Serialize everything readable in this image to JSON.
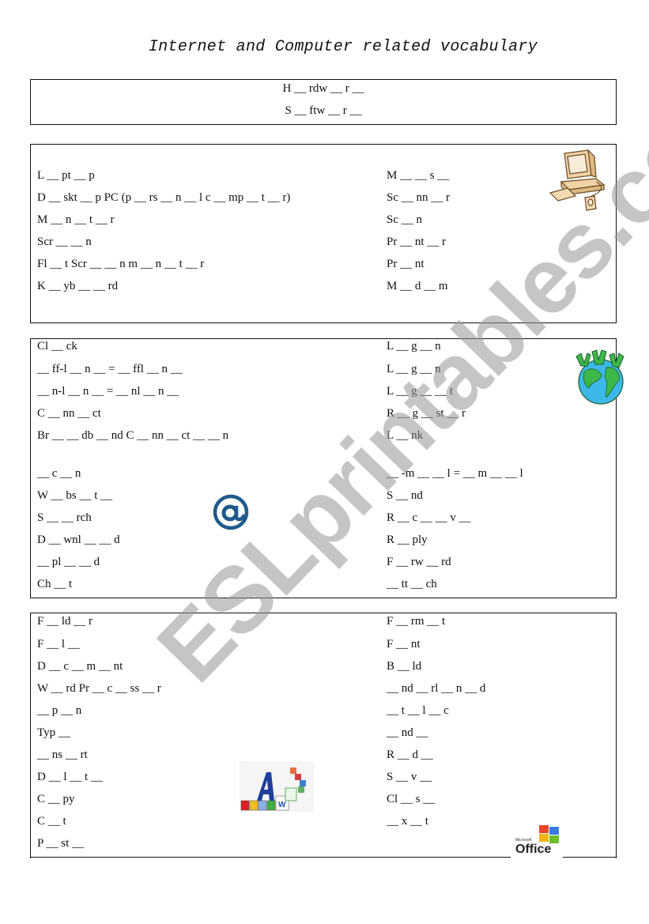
{
  "title": "Internet and Computer related vocabulary",
  "watermark": "ESLprintables.com",
  "box1": {
    "items": [
      "H __ rdw __ r __",
      "S __ ftw __ r __"
    ]
  },
  "box2": {
    "left": [
      "L __ pt __ p",
      "D __ skt __ p PC (p __ rs __ n __ l c __ mp __ t __ r)",
      "M __ n __ t __ r",
      "Scr __  __ n",
      "Fl __ t Scr __  __ n m __ n __ t __ r",
      "K __ yb __  __ rd"
    ],
    "right": [
      "M __  __ s __",
      "Sc __ nn __ r",
      "Sc __ n",
      "Pr __ nt __ r",
      "Pr __ nt",
      "M __ d __ m"
    ]
  },
  "box3": {
    "left": [
      "Cl __ ck",
      " __ ff-l __ n __  =  __ ffl __ n __",
      " __ n-l __ n __  =  __ nl __ n __",
      "C __ nn __ ct",
      "Br __  __ db __ nd C __ nn __ ct __  __ n",
      " __ c __ n",
      "W __ bs __ t __",
      "S __  __ rch",
      "D __ wnl __  __ d",
      " __ pl __  __ d",
      "Ch __ t"
    ],
    "right": [
      "L __ g __ n",
      "L __ g __ n",
      "L __ g __  __ t",
      "R __ g __ st __ r",
      "L __ nk",
      " __ -m __  __ l =  __ m __  __ l",
      "S __ nd",
      "R __ c __  __ v __",
      "R __ ply",
      "F __ rw __ rd",
      " __ tt __ ch"
    ]
  },
  "box4": {
    "left": [
      "F __ ld __ r",
      "F __ l __",
      "D __ c __ m __ nt",
      "W __ rd Pr __ c __ ss __ r",
      " __ p __ n",
      "Typ __",
      " __ ns __ rt",
      "D __ l __ t __",
      "C __ py",
      "C __ t",
      "P __ st __"
    ],
    "right": [
      "F __ rm __ t",
      "F __ nt",
      "B __ ld",
      " __ nd __ rl __ n __ d",
      " __ t __ l __ c",
      " __ nd __",
      "R __ d __",
      "S __ v __",
      "Cl __ s __",
      " __ x __ t"
    ]
  },
  "logo": {
    "small": "Microsoft",
    "large": "Office"
  },
  "colors": {
    "computer": "#e8c99a",
    "globe_water": "#3cb8e8",
    "globe_land": "#3cb84a",
    "at_sign": "#1f5a8c",
    "watermark": "#999999"
  }
}
